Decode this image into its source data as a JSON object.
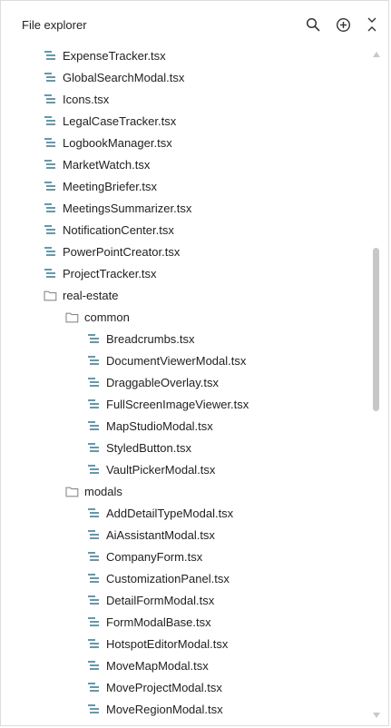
{
  "header": {
    "title": "File explorer",
    "icons": [
      "search-icon",
      "add-circle-icon",
      "collapse-all-icon"
    ]
  },
  "colors": {
    "file_icon": "#3f7f95",
    "folder_icon": "#8a8a8a",
    "text": "#222222",
    "scrollbar": "#c7c7c7"
  },
  "tree": [
    {
      "type": "file",
      "depth": 0,
      "label": "ExpenseTracker.tsx"
    },
    {
      "type": "file",
      "depth": 0,
      "label": "GlobalSearchModal.tsx"
    },
    {
      "type": "file",
      "depth": 0,
      "label": "Icons.tsx"
    },
    {
      "type": "file",
      "depth": 0,
      "label": "LegalCaseTracker.tsx"
    },
    {
      "type": "file",
      "depth": 0,
      "label": "LogbookManager.tsx"
    },
    {
      "type": "file",
      "depth": 0,
      "label": "MarketWatch.tsx"
    },
    {
      "type": "file",
      "depth": 0,
      "label": "MeetingBriefer.tsx"
    },
    {
      "type": "file",
      "depth": 0,
      "label": "MeetingsSummarizer.tsx"
    },
    {
      "type": "file",
      "depth": 0,
      "label": "NotificationCenter.tsx"
    },
    {
      "type": "file",
      "depth": 0,
      "label": "PowerPointCreator.tsx"
    },
    {
      "type": "file",
      "depth": 0,
      "label": "ProjectTracker.tsx"
    },
    {
      "type": "folder",
      "depth": 0,
      "label": "real-estate"
    },
    {
      "type": "folder",
      "depth": 1,
      "label": "common"
    },
    {
      "type": "file",
      "depth": 2,
      "label": "Breadcrumbs.tsx"
    },
    {
      "type": "file",
      "depth": 2,
      "label": "DocumentViewerModal.tsx"
    },
    {
      "type": "file",
      "depth": 2,
      "label": "DraggableOverlay.tsx"
    },
    {
      "type": "file",
      "depth": 2,
      "label": "FullScreenImageViewer.tsx"
    },
    {
      "type": "file",
      "depth": 2,
      "label": "MapStudioModal.tsx"
    },
    {
      "type": "file",
      "depth": 2,
      "label": "StyledButton.tsx"
    },
    {
      "type": "file",
      "depth": 2,
      "label": "VaultPickerModal.tsx"
    },
    {
      "type": "folder",
      "depth": 1,
      "label": "modals"
    },
    {
      "type": "file",
      "depth": 2,
      "label": "AddDetailTypeModal.tsx"
    },
    {
      "type": "file",
      "depth": 2,
      "label": "AiAssistantModal.tsx"
    },
    {
      "type": "file",
      "depth": 2,
      "label": "CompanyForm.tsx"
    },
    {
      "type": "file",
      "depth": 2,
      "label": "CustomizationPanel.tsx"
    },
    {
      "type": "file",
      "depth": 2,
      "label": "DetailFormModal.tsx"
    },
    {
      "type": "file",
      "depth": 2,
      "label": "FormModalBase.tsx"
    },
    {
      "type": "file",
      "depth": 2,
      "label": "HotspotEditorModal.tsx"
    },
    {
      "type": "file",
      "depth": 2,
      "label": "MoveMapModal.tsx"
    },
    {
      "type": "file",
      "depth": 2,
      "label": "MoveProjectModal.tsx"
    },
    {
      "type": "file",
      "depth": 2,
      "label": "MoveRegionModal.tsx"
    }
  ]
}
